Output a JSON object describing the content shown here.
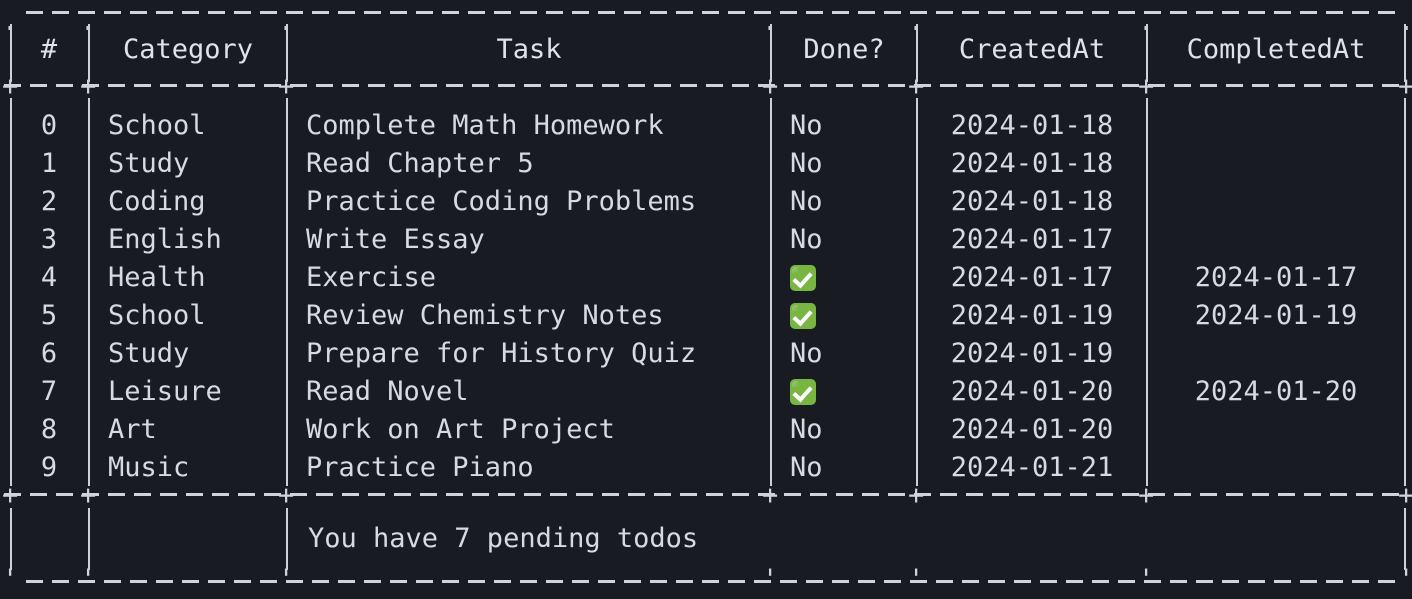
{
  "terminal": {
    "background_color": "#181b21",
    "foreground_color": "#d7dae0",
    "border_color": "#cfd3da",
    "check_color": "#78b543"
  },
  "table": {
    "columns": [
      {
        "key": "index",
        "label": "#",
        "align": "center"
      },
      {
        "key": "category",
        "label": "Category",
        "align": "left"
      },
      {
        "key": "task",
        "label": "Task",
        "align": "left"
      },
      {
        "key": "done",
        "label": "Done?",
        "align": "left"
      },
      {
        "key": "created_at",
        "label": "CreatedAt",
        "align": "center"
      },
      {
        "key": "completed_at",
        "label": "CompletedAt",
        "align": "center"
      }
    ],
    "rows": [
      {
        "index": "0",
        "category": "School",
        "task": "Complete Math Homework",
        "done": "No",
        "done_icon": "",
        "created_at": "2024-01-18",
        "completed_at": ""
      },
      {
        "index": "1",
        "category": "Study",
        "task": "Read Chapter 5",
        "done": "No",
        "done_icon": "",
        "created_at": "2024-01-18",
        "completed_at": ""
      },
      {
        "index": "2",
        "category": "Coding",
        "task": "Practice Coding Problems",
        "done": "No",
        "done_icon": "",
        "created_at": "2024-01-18",
        "completed_at": ""
      },
      {
        "index": "3",
        "category": "English",
        "task": "Write Essay",
        "done": "No",
        "done_icon": "",
        "created_at": "2024-01-17",
        "completed_at": ""
      },
      {
        "index": "4",
        "category": "Health",
        "task": "Exercise",
        "done": "",
        "done_icon": "check-mark-icon",
        "created_at": "2024-01-17",
        "completed_at": "2024-01-17"
      },
      {
        "index": "5",
        "category": "School",
        "task": "Review Chemistry Notes",
        "done": "",
        "done_icon": "check-mark-icon",
        "created_at": "2024-01-19",
        "completed_at": "2024-01-19"
      },
      {
        "index": "6",
        "category": "Study",
        "task": "Prepare for History Quiz",
        "done": "No",
        "done_icon": "",
        "created_at": "2024-01-19",
        "completed_at": ""
      },
      {
        "index": "7",
        "category": "Leisure",
        "task": "Read Novel",
        "done": "",
        "done_icon": "check-mark-icon",
        "created_at": "2024-01-20",
        "completed_at": "2024-01-20"
      },
      {
        "index": "8",
        "category": "Art",
        "task": "Work on Art Project",
        "done": "No",
        "done_icon": "",
        "created_at": "2024-01-20",
        "completed_at": ""
      },
      {
        "index": "9",
        "category": "Music",
        "task": "Practice Piano",
        "done": "No",
        "done_icon": "",
        "created_at": "2024-01-21",
        "completed_at": ""
      }
    ],
    "footer": {
      "text": "You have 7 pending todos",
      "pending_count": "7"
    }
  }
}
